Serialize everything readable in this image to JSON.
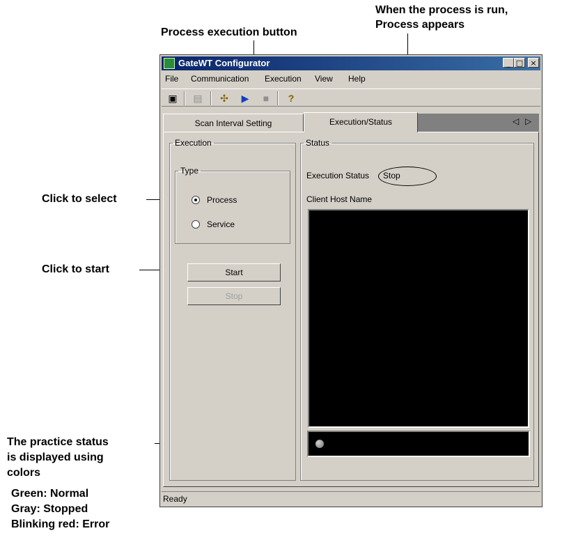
{
  "callouts": {
    "process_exec_button": "Process execution button",
    "when_run_line1": "When the process is run,",
    "when_run_line2": "Process appears",
    "click_select": "Click to select",
    "click_start": "Click to start",
    "status_line1": "The practice status",
    "status_line2": "is displayed using",
    "status_line3": "colors",
    "status_line4": "Green: Normal",
    "status_line5": "Gray: Stopped",
    "status_line6": "Blinking red: Error"
  },
  "window": {
    "title": "GateWT Configurator",
    "minimize": "_",
    "maximize": "□",
    "close": "×"
  },
  "menu": [
    "File",
    "Communication",
    "Execution",
    "View",
    "Help"
  ],
  "toolbar": {
    "icons": [
      "save-icon",
      "connect-icon",
      "service-run-icon",
      "process-run-icon",
      "stop-icon",
      "help-icon"
    ],
    "glyphs": [
      "▣",
      "▤",
      "✣",
      "▶",
      "■",
      "?"
    ]
  },
  "tabs": {
    "items": [
      "Scan Interval Setting",
      "Execution/Status"
    ],
    "active": "Execution/Status",
    "prev": "◁",
    "next": "▷"
  },
  "execution": {
    "group_label": "Execution",
    "type_label": "Type",
    "options": [
      "Process",
      "Service"
    ],
    "selected": "Process",
    "start_label": "Start",
    "stop_label": "Stop"
  },
  "status": {
    "group_label": "Status",
    "exec_status_label": "Execution Status",
    "exec_status_value": "Stop",
    "client_host_label": "Client Host Name",
    "led_color": "#808080"
  },
  "statusbar": {
    "text": "Ready"
  }
}
